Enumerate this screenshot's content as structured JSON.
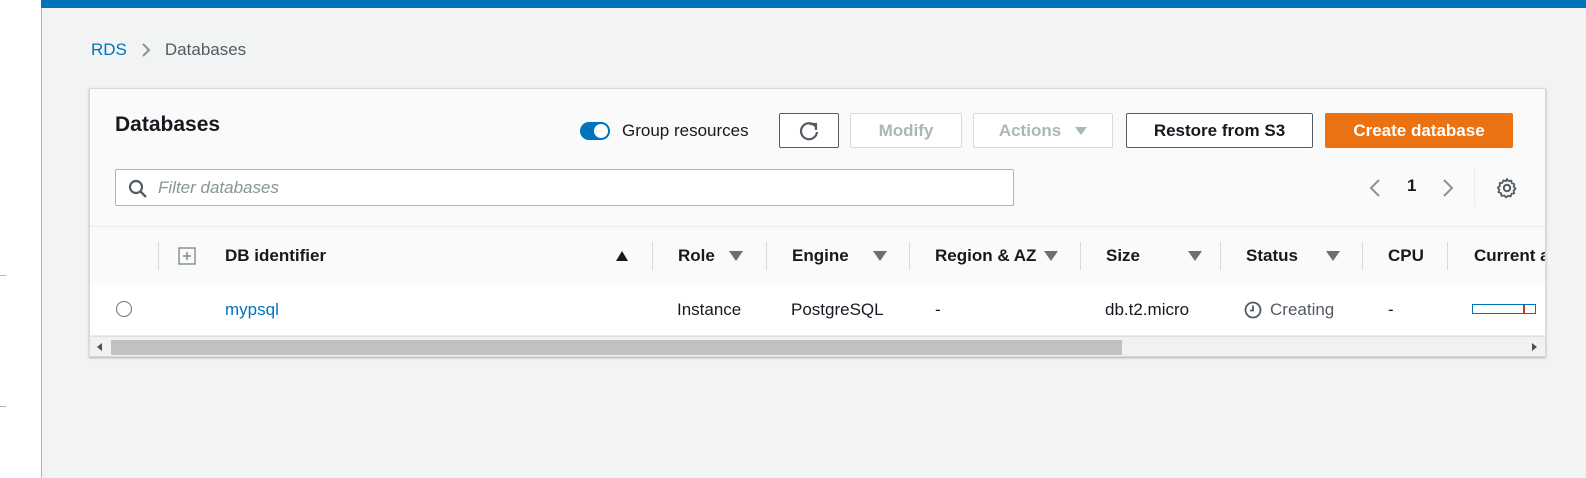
{
  "breadcrumb": {
    "root": "RDS",
    "current": "Databases"
  },
  "panel": {
    "title": "Databases",
    "group_resources_label": "Group resources",
    "group_resources_on": true
  },
  "toolbar": {
    "refresh_icon": "refresh-icon",
    "modify_label": "Modify",
    "actions_label": "Actions",
    "restore_label": "Restore from S3",
    "create_label": "Create database"
  },
  "filter": {
    "placeholder": "Filter databases",
    "value": ""
  },
  "pagination": {
    "current_page": "1"
  },
  "table": {
    "columns": [
      "DB identifier",
      "Role",
      "Engine",
      "Region & AZ",
      "Size",
      "Status",
      "CPU",
      "Current a"
    ],
    "rows": [
      {
        "identifier": "mypsql",
        "role": "Instance",
        "engine": "PostgreSQL",
        "region": "-",
        "size": "db.t2.micro",
        "status": "Creating",
        "cpu": "-"
      }
    ]
  },
  "colors": {
    "accent": "#0073bb",
    "primary_button": "#ec7211",
    "marker": "#d13212"
  }
}
